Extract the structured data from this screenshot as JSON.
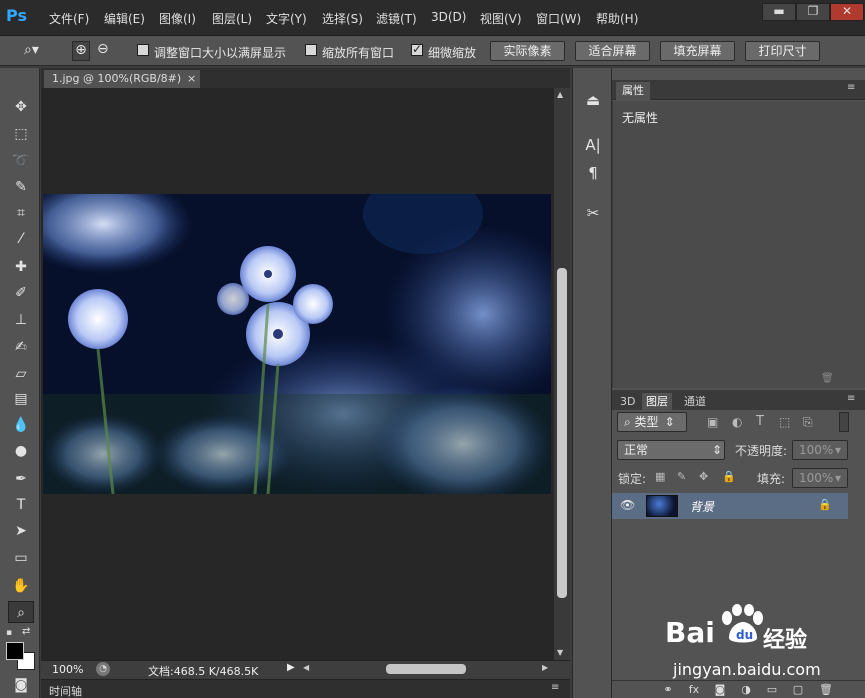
{
  "app": {
    "logo": "Ps",
    "menus": [
      "文件(F)",
      "编辑(E)",
      "图像(I)",
      "图层(L)",
      "文字(Y)",
      "选择(S)",
      "滤镜(T)",
      "3D(D)",
      "视图(V)",
      "窗口(W)",
      "帮助(H)"
    ],
    "window_buttons": {
      "minimize": "▬",
      "restore": "❐",
      "close": "✕"
    }
  },
  "options": {
    "checkbox1_label": "调整窗口大小以满屏显示",
    "checkbox1_checked": false,
    "checkbox2_label": "缩放所有窗口",
    "checkbox2_checked": false,
    "checkbox3_label": "细微缩放",
    "checkbox3_checked": true,
    "btn_actual": "实际像素",
    "btn_fit": "适合屏幕",
    "btn_fill": "填充屏幕",
    "btn_print": "打印尺寸"
  },
  "document": {
    "tab_title": "1.jpg @ 100%(RGB/8#)",
    "tab_close": "×",
    "zoom": "100%",
    "doc_info": "文档:468.5 K/468.5K"
  },
  "timeline": {
    "label": "时间轴"
  },
  "properties": {
    "tab": "属性",
    "body": "无属性"
  },
  "layers": {
    "tabs": [
      "3D",
      "图层",
      "通道"
    ],
    "filter_kind": "类型",
    "blend_mode": "正常",
    "opacity_label": "不透明度:",
    "opacity_value": "100%",
    "lock_label": "锁定:",
    "fill_label": "填充:",
    "fill_value": "100%",
    "layer_name": "背景"
  },
  "watermark": {
    "brand": "Bai",
    "brand2": "经验",
    "url": "jingyan.baidu.com"
  }
}
